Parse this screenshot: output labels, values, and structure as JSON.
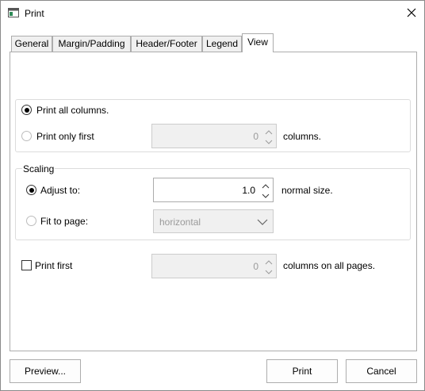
{
  "window": {
    "title": "Print"
  },
  "tabs": [
    {
      "label": "General",
      "active": false
    },
    {
      "label": "Margin/Padding",
      "active": false
    },
    {
      "label": "Header/Footer",
      "active": false
    },
    {
      "label": "Legend",
      "active": false
    },
    {
      "label": "View",
      "active": true
    }
  ],
  "columns_group": {
    "print_all": {
      "label": "Print all columns.",
      "selected": true
    },
    "print_first": {
      "label": "Print only first",
      "selected": false,
      "value": "0",
      "suffix": "columns."
    }
  },
  "scaling_group": {
    "caption": "Scaling",
    "adjust_to": {
      "label": "Adjust to:",
      "selected": true,
      "value": "1.0",
      "suffix": "normal size."
    },
    "fit_to_page": {
      "label": "Fit to page:",
      "selected": false,
      "value": "horizontal"
    }
  },
  "repeat_columns": {
    "label": "Print first",
    "checked": false,
    "value": "0",
    "suffix": "columns on all pages."
  },
  "buttons": {
    "preview": "Preview...",
    "print": "Print",
    "cancel": "Cancel"
  }
}
